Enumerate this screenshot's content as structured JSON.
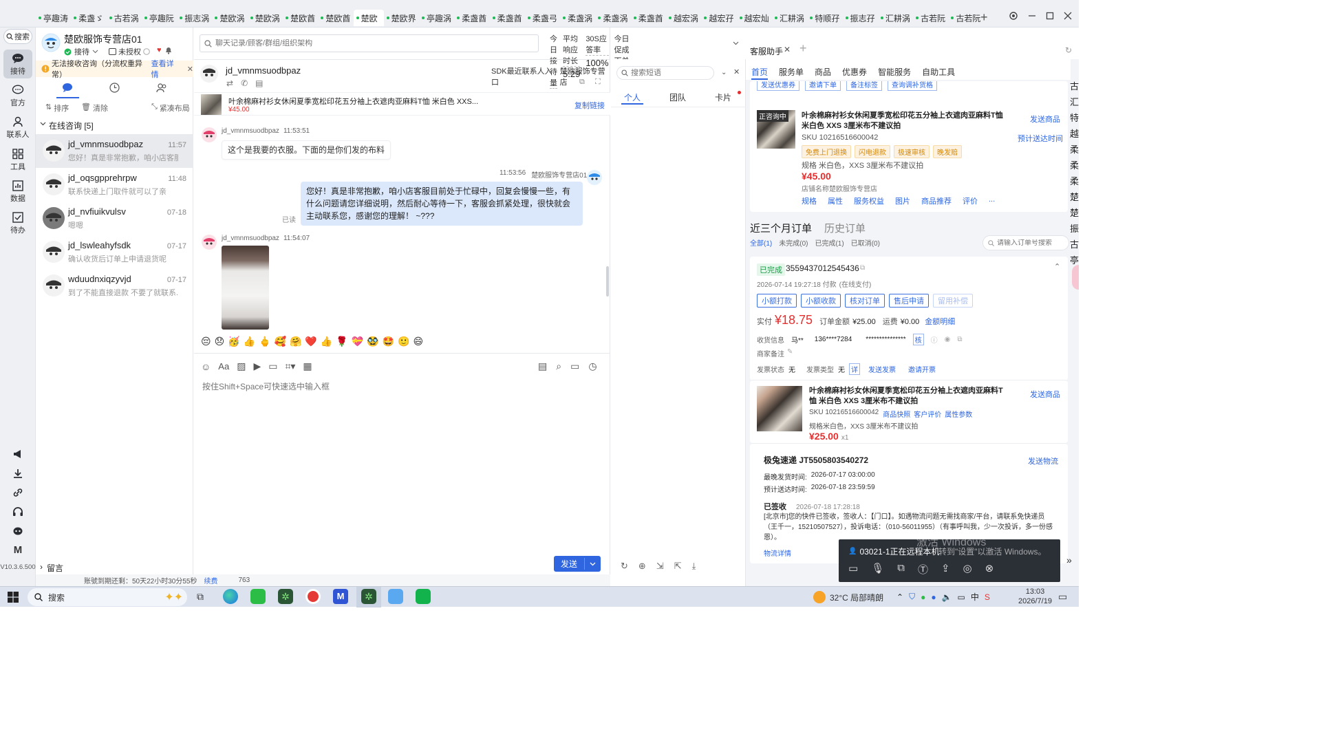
{
  "tabs": {
    "items": [
      "亭趣涛",
      "柔盏ゞ",
      "古若涡",
      "亭趣阮",
      "振志涡",
      "楚欧涡",
      "楚欧涡",
      "楚欧酋",
      "楚欧酋",
      "楚欧",
      "楚欧界",
      "亭趣涡",
      "柔盏酋",
      "柔盏酋",
      "柔盏弓",
      "柔盏涡",
      "柔盏涡",
      "柔盏酋",
      "越宏涡",
      "越宏孖",
      "越宏灿",
      "汇耕涡",
      "特顺孖",
      "振志孖",
      "汇耕涡",
      "古若阮",
      "古若阮"
    ],
    "active_index": 9,
    "new_tab": "+"
  },
  "rail": {
    "search": "搜索",
    "items": [
      "接待",
      "官方",
      "联系人",
      "工具",
      "数据",
      "待办"
    ],
    "version": "V10.3.6.500"
  },
  "store": {
    "name": "楚欧服饰专营店01",
    "status": "接待",
    "auth": "未授权"
  },
  "warning": {
    "text": "无法接收咨询（分流权重异常）",
    "link": "查看详情"
  },
  "session_tools": {
    "sort": "排序",
    "clear": "清除",
    "layout": "紧凑布局"
  },
  "online_group": "在线咨询 [5]",
  "sessions": [
    {
      "name": "jd_vmnmsuodbpaz",
      "time": "11:57",
      "preview": "您好！真是非常抱歉，咱小店客服..."
    },
    {
      "name": "jd_oqsgpprehrpw",
      "time": "11:48",
      "preview": "联系快递上门取件就可以了亲"
    },
    {
      "name": "jd_nvfiuikvulsv",
      "time": "07-18",
      "preview": "嗯嗯"
    },
    {
      "name": "jd_lswleahyfsdk",
      "time": "07-17",
      "preview": "确认收货后订单上申请退货呢"
    },
    {
      "name": "wduudnxiqzyvjd",
      "time": "07-17",
      "preview": "到了不能直接退款 不要了就联系..."
    }
  ],
  "leave_msg": "留言",
  "bottom_notice": {
    "text": "账號到期还剩：50天22小时30分55秒",
    "link": "续费",
    "num": "763"
  },
  "header": {
    "search_placeholder": "聊天记录/顾客/群组/组织架构",
    "stats": [
      {
        "label": "今日接待量",
        "value": "1"
      },
      {
        "label": "平均响应时长",
        "value": "5.29"
      },
      {
        "label": "30S应答率",
        "value": "100%"
      },
      {
        "label": "今日促成下单金额",
        "value": "0.00"
      }
    ]
  },
  "chat": {
    "customer": "jd_vmnmsuodbpaz",
    "sdk_link": "SDK最近联系人入口",
    "store_label": "楚欧服饰专营店",
    "product_title": "叶余棉麻衬衫女休闲夏季宽松印花五分袖上衣遮肉亚麻料T恤 米白色 XXS...",
    "product_price": "¥45.00",
    "copy_link": "复制链接",
    "messages": [
      {
        "from": "jd_vmnmsuodbpaz",
        "time": "11:53:51",
        "text": "这个是我要的衣服。下面的是你们发的布料"
      },
      {
        "from": "楚欧服饰专营店01",
        "time": "11:53:56",
        "read": "已读",
        "text": "您好！真是非常抱歉，咱小店客服目前处于忙碌中，回复会慢慢一些，有什么问题请您详细说明，然后耐心等待一下，客服会抓紧处理，很快就会主动联系您，感谢您的理解！ ~???"
      },
      {
        "from": "jd_vmnmsuodbpaz",
        "time": "11:54:07",
        "text": ""
      }
    ],
    "emojis": [
      "😔",
      "😞",
      "🥳",
      "👍",
      "🖕",
      "🥰",
      "🤗",
      "❤️",
      "👍",
      "🌹",
      "💝",
      "🥸",
      "🤩",
      "🙂",
      "😄"
    ],
    "input_placeholder": "按住Shift+Space可快速选中输入框",
    "send": "发送"
  },
  "phrases": {
    "search_placeholder": "搜索短语",
    "tabs": [
      "个人",
      "团队",
      "卡片"
    ]
  },
  "assistant": {
    "tab_title": "客服助手",
    "nav": [
      "首页",
      "服务单",
      "商品",
      "优惠券",
      "智能服务",
      "自助工具"
    ],
    "top_buttons": [
      "发送优惠券",
      "邀请下单",
      "备注标签",
      "查询调补货格"
    ],
    "product": {
      "badge": "正咨询中",
      "title": "叶余棉麻衬衫女休闲夏季宽松印花五分袖上衣遮肉亚麻料T恤 米白色 XXS 3厘米布不建议拍",
      "sku": "SKU 10216516600042",
      "tags": [
        "免费上门退换",
        "闪电退款",
        "极速审核",
        "晚发赔"
      ],
      "spec": "规格 米白色，XXS 3厘米布不建议拍",
      "price": "¥45.00",
      "store": "店铺名称楚欧服饰专营店",
      "links": [
        "规格",
        "属性",
        "服务权益",
        "图片",
        "商品推荐",
        "评价",
        "..."
      ],
      "send": "发送商品",
      "eta": "预计送达时间"
    },
    "orders": {
      "title": "近三个月订单",
      "history": "历史订单",
      "filters": [
        "全部(1)",
        "未完成(0)",
        "已完成(1)",
        "已取消(0)"
      ],
      "search_placeholder": "请输入订单号搜索",
      "status": "已完成",
      "order_no": "3559437012545436",
      "paid_time": "2026-07-14 19:27:18 付款",
      "pay_type": "(在线支付)",
      "actions": [
        "小额打款",
        "小额收款",
        "核对订单",
        "售后申请",
        "留用补偿"
      ],
      "actual_label": "实付",
      "actual": "¥18.75",
      "amount_label": "订单金额",
      "amount": "¥25.00",
      "freight_label": "运费",
      "freight": "¥0.00",
      "detail_link": "金额明细",
      "receiver_label": "收货信息",
      "receiver_name": "马**",
      "receiver_phone": "136****7284",
      "receiver_addr": "***************",
      "check": "核",
      "merchant_note": "商家备注",
      "invoice_status_label": "发票状态",
      "invoice_status": "无",
      "invoice_type_label": "发票类型",
      "invoice_type": "无",
      "invoice_detail": "详",
      "send_invoice": "发送发票",
      "invite_invoice": "邀请开票",
      "item_title": "叶余棉麻衬衫女休闲夏季宽松印花五分袖上衣遮肉亚麻料T恤 米白色 XXS 3厘米布不建议拍",
      "item_sku": "SKU 10216516600042",
      "item_links": [
        "商品快照",
        "客户评价",
        "属性参数"
      ],
      "item_spec": "规格米白色，XXS 3厘米布不建议拍",
      "item_price": "¥25.00",
      "item_qty": "x1",
      "item_send": "发送商品",
      "shipping_title": "极兔速递 JT5505803540272",
      "shipping_send": "发送物流",
      "latest_ship_label": "最晚发货时间:",
      "latest_ship": "2026-07-17 03:00:00",
      "eta_label": "预计送达时间:",
      "eta": "2026-07-18 23:59:59",
      "signed": "已签收",
      "signed_time": "2026-07-18 17:28:18",
      "signed_text": "[北京市]您的快件已签收，签收人：【门口】。如遇物流问题无需找商家/平台，请联系免快递员（王千一，15210507527），投诉电话：（010-56011955）（有事呼叫我，少一次投诉，多一份感恩）。",
      "logistics_link": "物流详情"
    }
  },
  "side_strip": [
    "古",
    "汇",
    "特",
    "越",
    "柔",
    "柔",
    "柔",
    "楚",
    "楚",
    "振",
    "古",
    "亭"
  ],
  "remote": {
    "text": "03021-1正在远程本机",
    "watermark1": "激活 Windows",
    "watermark2": "转到\"设置\"以激活 Windows。"
  },
  "taskbar": {
    "search": "搜索",
    "weather": "32°C 局部晴朗",
    "ime": "中",
    "time": "13:03",
    "date": "2026/7/19"
  }
}
